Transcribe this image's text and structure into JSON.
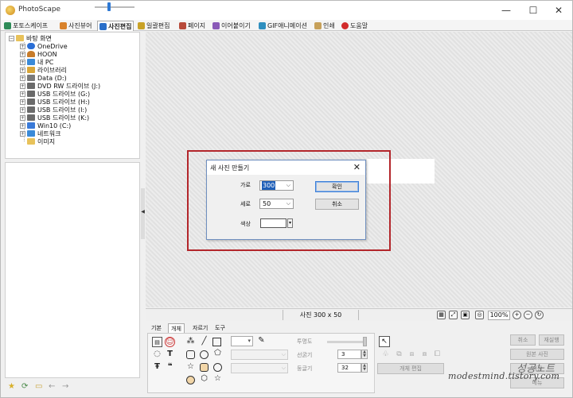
{
  "app": {
    "title": "PhotoScape",
    "controls": {
      "minimize": "—",
      "maximize": "☐",
      "close": "✕"
    }
  },
  "menu": {
    "tabs": [
      {
        "label": "포토스케이프",
        "icon_color": "#2e8b57"
      },
      {
        "label": "사진뷰어",
        "icon_color": "#d9822b"
      },
      {
        "label": "사진편집",
        "icon_color": "#2a6fc9"
      },
      {
        "label": "일괄편집",
        "icon_color": "#c9a227"
      },
      {
        "label": "페이지",
        "icon_color": "#b84a3a"
      },
      {
        "label": "이어붙이기",
        "icon_color": "#8a5ab8"
      },
      {
        "label": "GIF애니메이션",
        "icon_color": "#2f8fbf"
      },
      {
        "label": "인쇄",
        "icon_color": "#c7a15a"
      },
      {
        "label": "도움말",
        "icon_color": "#d22b2b"
      }
    ]
  },
  "tree": {
    "root": "바탕 화면",
    "items": [
      {
        "label": "OneDrive",
        "icon": "cloud-icon",
        "color": "#2b6fd6"
      },
      {
        "label": "HOON",
        "icon": "user-icon",
        "color": "#c77c2b"
      },
      {
        "label": "내 PC",
        "icon": "computer-icon",
        "color": "#3a8ad8"
      },
      {
        "label": "라이브러리",
        "icon": "library-icon",
        "color": "#d8a63a"
      },
      {
        "label": "Data (D:)",
        "icon": "drive-icon",
        "color": "#7a7a7a"
      },
      {
        "label": "DVD RW 드라이브 (J:)",
        "icon": "dvd-drive-icon",
        "color": "#6a6a6a"
      },
      {
        "label": "USB 드라이브 (G:)",
        "icon": "usb-drive-icon",
        "color": "#6a6a6a"
      },
      {
        "label": "USB 드라이브 (H:)",
        "icon": "usb-drive-icon",
        "color": "#6a6a6a"
      },
      {
        "label": "USB 드라이브 (I:)",
        "icon": "usb-drive-icon",
        "color": "#6a6a6a"
      },
      {
        "label": "USB 드라이브 (K:)",
        "icon": "usb-drive-icon",
        "color": "#6a6a6a"
      },
      {
        "label": "Win10 (C:)",
        "icon": "windows-drive-icon",
        "color": "#3a7ad8"
      },
      {
        "label": "네트워크",
        "icon": "network-icon",
        "color": "#3a8ad8"
      },
      {
        "label": "이미지",
        "icon": "folder-icon",
        "color": "#e8c25a"
      }
    ]
  },
  "dialog": {
    "title": "새 사진 만들기",
    "close": "✕",
    "width_label": "가로",
    "width_value": "300",
    "height_label": "세로",
    "height_value": "50",
    "color_label": "색상",
    "color_value": "#ffffff",
    "ok_label": "확인",
    "cancel_label": "취소"
  },
  "status": {
    "text": "사진 300 x 50",
    "zoom": "100%"
  },
  "tools": {
    "tabs": [
      "기본",
      "개체",
      "자르기",
      "도구"
    ],
    "active_tab": "개체",
    "opacity_label": "투명도",
    "line_width_label": "선굵기",
    "line_width_value": "3",
    "round_label": "둥글기",
    "round_value": "32",
    "object_edit_label": "개체 편집",
    "cancel_label": "취소",
    "redo_label": "재실행",
    "original_label": "원본 사진",
    "save_label": "저장",
    "menu_label": "메뉴"
  },
  "watermark": {
    "ko": "성공노트",
    "url": "modestmind.tistory.com"
  }
}
